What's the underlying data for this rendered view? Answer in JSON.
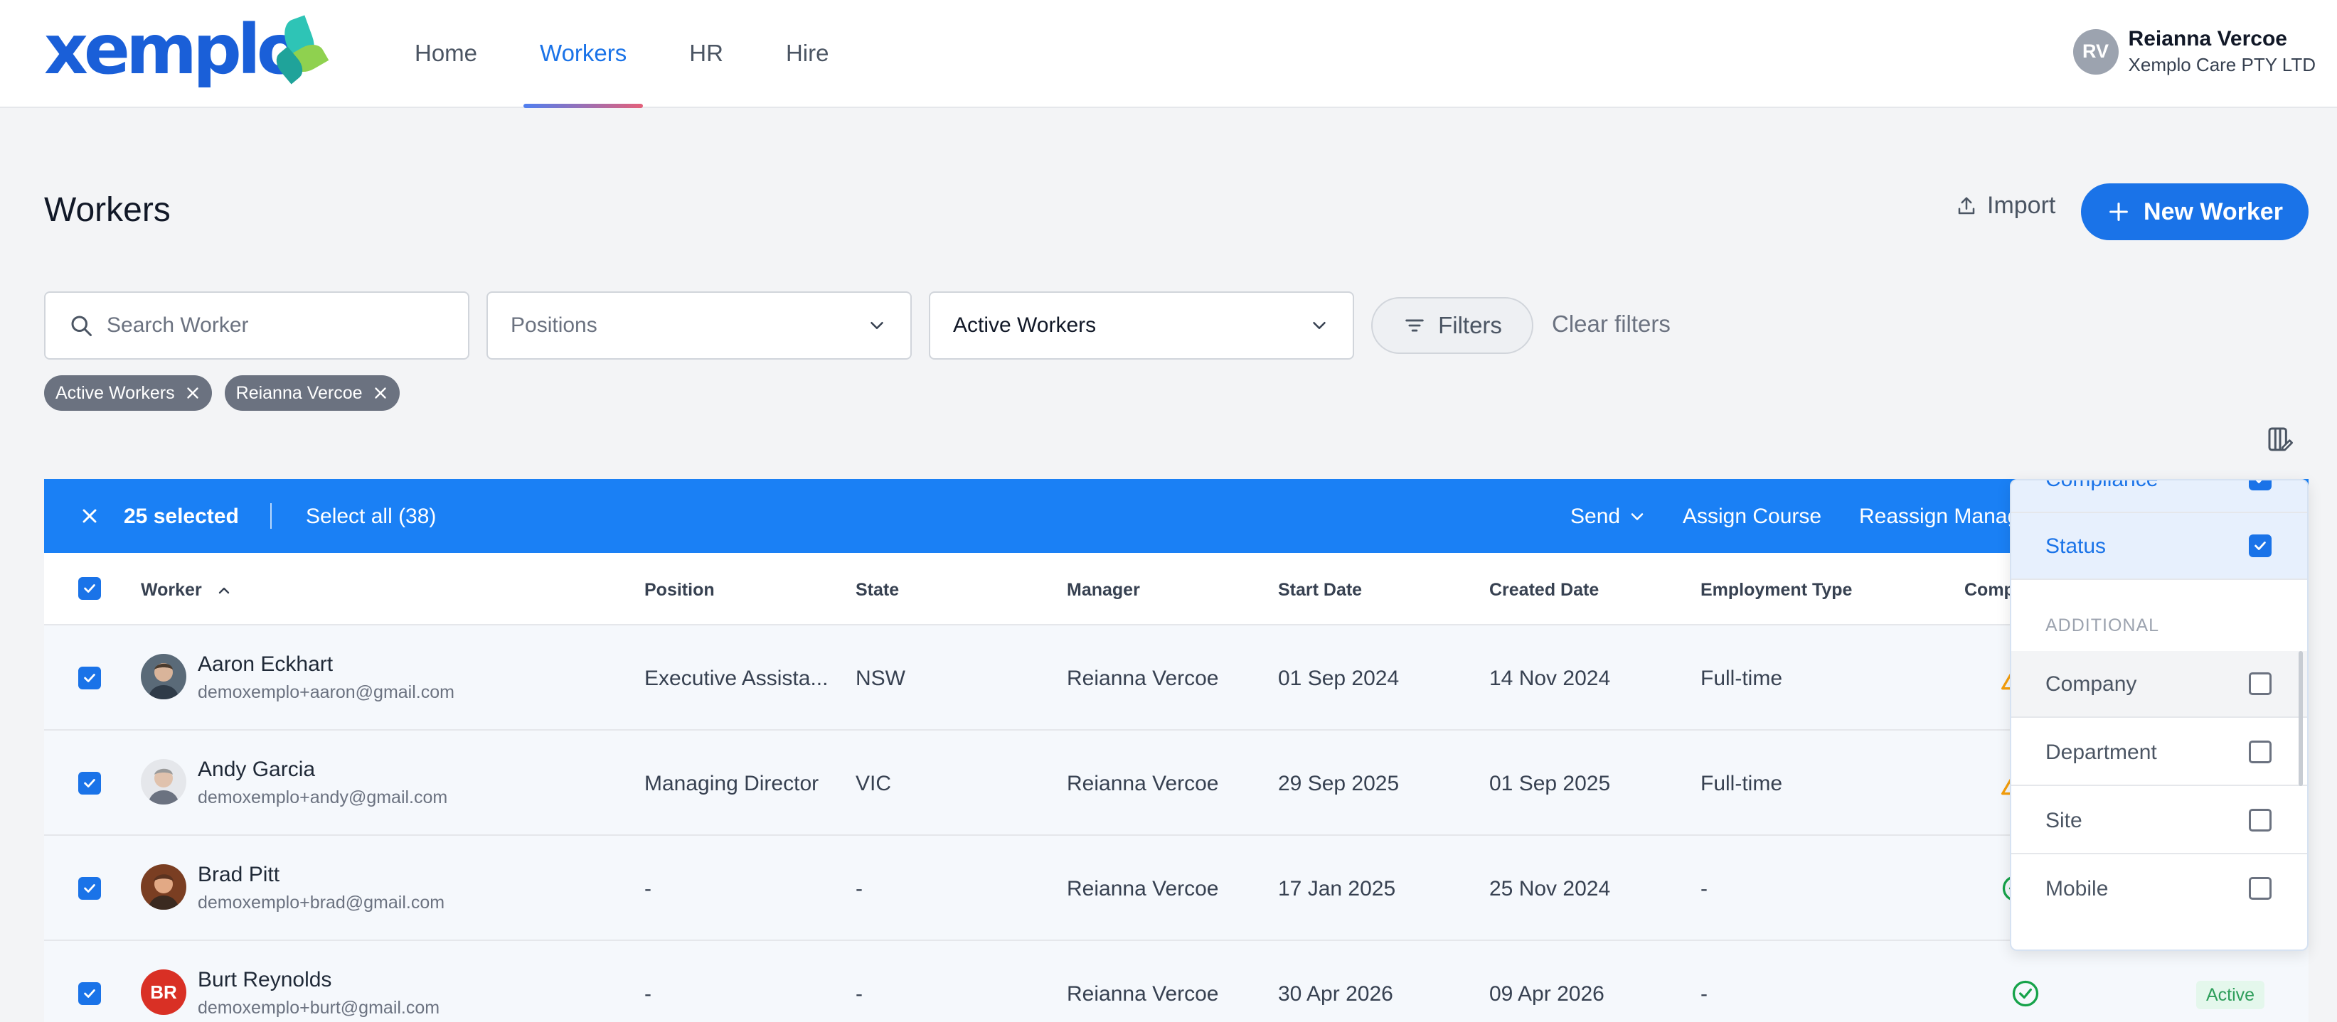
{
  "header": {
    "logo_text": "xemplo",
    "nav": [
      {
        "label": "Home",
        "active": false
      },
      {
        "label": "Workers",
        "active": true
      },
      {
        "label": "HR",
        "active": false
      },
      {
        "label": "Hire",
        "active": false
      }
    ],
    "user": {
      "initials": "RV",
      "name": "Reianna Vercoe",
      "company": "Xemplo Care PTY LTD"
    }
  },
  "page": {
    "title": "Workers",
    "import_label": "Import",
    "new_worker_label": "New Worker"
  },
  "filters": {
    "search_placeholder": "Search Worker",
    "positions_placeholder": "Positions",
    "status_value": "Active Workers",
    "filters_label": "Filters",
    "clear_label": "Clear filters",
    "chips": [
      "Active Workers",
      "Reianna Vercoe"
    ]
  },
  "bulk": {
    "selected_label": "25 selected",
    "select_all_label": "Select all (38)",
    "send_label": "Send",
    "assign_course_label": "Assign Course",
    "reassign_label": "Reassign Manager"
  },
  "table": {
    "columns": [
      "Worker",
      "Position",
      "State",
      "Manager",
      "Start Date",
      "Created Date",
      "Employment Type",
      "Compliance"
    ],
    "rows": [
      {
        "name": "Aaron Eckhart",
        "email": "demoxemplo+aaron@gmail.com",
        "position": "Executive Assista...",
        "state": "NSW",
        "manager": "Reianna Vercoe",
        "start": "01 Sep 2024",
        "created": "14 Nov 2024",
        "employment": "Full-time",
        "compliance": "warning",
        "status": "",
        "avatar_initials": "",
        "avatar_color": "#6b5b4f"
      },
      {
        "name": "Andy Garcia",
        "email": "demoxemplo+andy@gmail.com",
        "position": "Managing Director",
        "state": "VIC",
        "manager": "Reianna Vercoe",
        "start": "29 Sep 2025",
        "created": "01 Sep 2025",
        "employment": "Full-time",
        "compliance": "warning",
        "status": "",
        "avatar_initials": "",
        "avatar_color": "#a8a29e"
      },
      {
        "name": "Brad Pitt",
        "email": "demoxemplo+brad@gmail.com",
        "position": "-",
        "state": "-",
        "manager": "Reianna Vercoe",
        "start": "17 Jan 2025",
        "created": "25 Nov 2024",
        "employment": "-",
        "compliance": "ok",
        "status": "",
        "avatar_initials": "",
        "avatar_color": "#8a4b2f"
      },
      {
        "name": "Burt Reynolds",
        "email": "demoxemplo+burt@gmail.com",
        "position": "-",
        "state": "-",
        "manager": "Reianna Vercoe",
        "start": "30 Apr 2026",
        "created": "09 Apr 2026",
        "employment": "-",
        "compliance": "ok",
        "status": "Active",
        "avatar_initials": "BR",
        "avatar_color": "#d93025"
      }
    ]
  },
  "column_panel": {
    "items_top": [
      {
        "label": "Compliance",
        "checked": true
      },
      {
        "label": "Status",
        "checked": true
      }
    ],
    "section_label": "ADDITIONAL",
    "items_additional": [
      {
        "label": "Company",
        "checked": false
      },
      {
        "label": "Department",
        "checked": false
      },
      {
        "label": "Site",
        "checked": false
      },
      {
        "label": "Mobile",
        "checked": false
      }
    ]
  },
  "colors": {
    "primary": "#1a73e8",
    "bulk_bar": "#1a80f5",
    "status_active_text": "#2e9e5b",
    "status_active_bg": "#e4f7ec",
    "warning": "#f59e0b",
    "ok": "#16a34a"
  }
}
